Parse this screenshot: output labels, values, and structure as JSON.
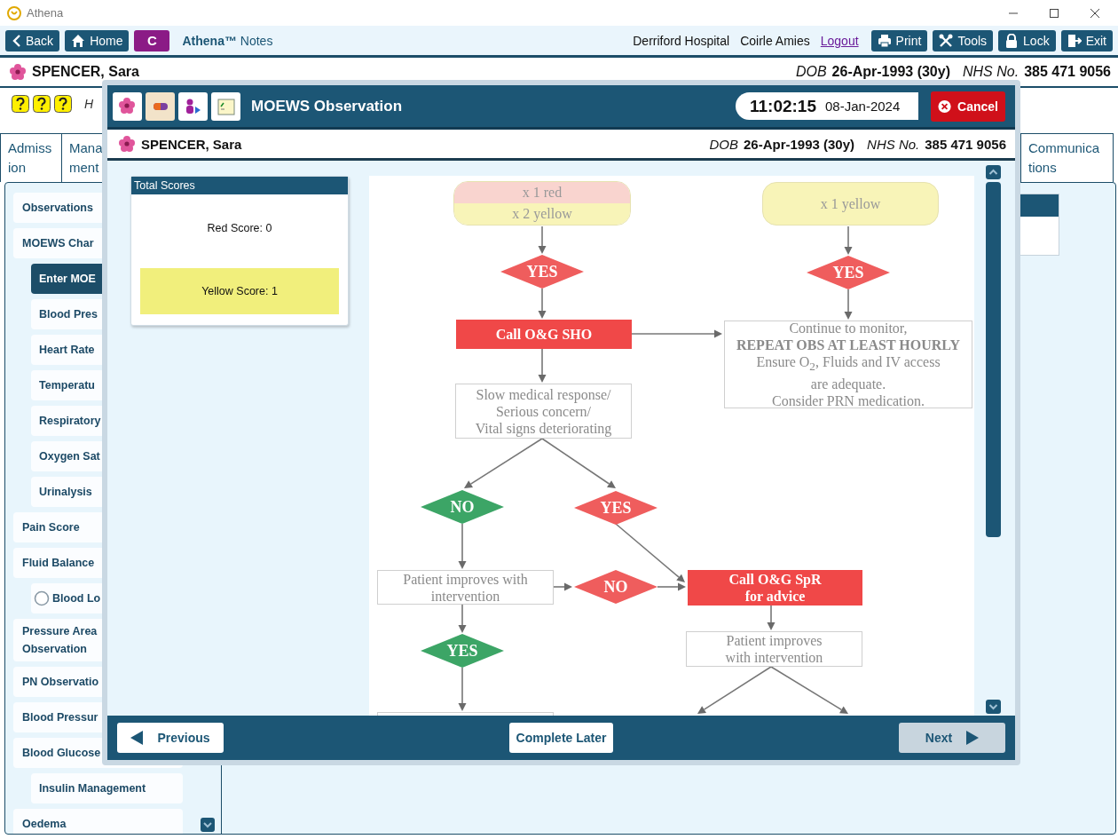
{
  "app": {
    "title": "Athena"
  },
  "toolbar": {
    "left_buttons": [
      {
        "label": "Back",
        "kind": "back"
      },
      {
        "label": "Home",
        "kind": "home"
      }
    ],
    "badge": "C",
    "app_name": "**Athena™** Notes",
    "hospital": "Derriford Hospital",
    "user": "Coirle Amies",
    "logout": "Logout",
    "right_buttons": [
      {
        "label": "Print",
        "kind": "print"
      },
      {
        "label": "Tools",
        "kind": "tools"
      },
      {
        "label": "Lock",
        "kind": "lock"
      },
      {
        "label": "Exit",
        "kind": "exit"
      }
    ]
  },
  "patient": {
    "name": "SPENCER, Sara",
    "dob_label": "DOB",
    "dob": "26-Apr-1993 (30y)",
    "nhs_label": "NHS No.",
    "nhs": "385 471 9056"
  },
  "alerts": {
    "note": "H"
  },
  "tabs": [
    {
      "lines": [
        "Admiss",
        "ion"
      ],
      "selected": false
    },
    {
      "lines": [
        "Mana",
        "ment"
      ],
      "selected": false
    },
    {
      "lines": [
        "Communica",
        "tions"
      ],
      "selected": false
    }
  ],
  "nav": [
    {
      "label": "Observations",
      "selected": false
    },
    {
      "label": "MOEWS Char",
      "selected": false,
      "children": [
        {
          "label": "Enter MOE",
          "selected": true
        },
        {
          "label": "Blood Pres",
          "selected": false
        },
        {
          "label": "Heart Rate",
          "selected": false
        },
        {
          "label": "Temperatu",
          "selected": false
        },
        {
          "label": "Respiratory",
          "selected": false
        },
        {
          "label": "Oxygen Sat",
          "selected": false
        },
        {
          "label": "Urinalysis",
          "selected": false
        }
      ]
    },
    {
      "label": "Pain Score",
      "selected": false
    },
    {
      "label": "Fluid Balance",
      "selected": false,
      "children": [
        {
          "label": "Blood Lo",
          "selected": false,
          "kind": "radio",
          "checked": false
        }
      ]
    },
    {
      "label": "Pressure Area\nObservation",
      "selected": false
    },
    {
      "label": "PN Observatio",
      "selected": false
    },
    {
      "label": "Blood Pressur",
      "selected": false
    },
    {
      "label": "Blood Glucose",
      "selected": false,
      "children": [
        {
          "label": "Insulin Management",
          "selected": false
        }
      ]
    },
    {
      "label": "Oedema",
      "selected": false
    }
  ],
  "modal": {
    "title": "MOEWS Observation",
    "time": "11:02:15",
    "date": "08-Jan-2024",
    "cancel": "Cancel",
    "patient": {
      "name": "SPENCER, Sara",
      "dob_label": "DOB",
      "dob": "26-Apr-1993 (30y)",
      "nhs_label": "NHS No.",
      "nhs": "385 471 9056"
    },
    "scores": {
      "title": "Total Scores",
      "red": "Red Score: 0",
      "yellow": "Yellow Score: 1"
    },
    "flowchart": {
      "nodes": [
        {
          "kind": "split_terminal",
          "parts": [
            {
              "text": "x 1 red",
              "color": "#f9d4cf"
            },
            {
              "text": "x 2 yellow",
              "color": "#f8f4b8"
            }
          ]
        },
        {
          "kind": "terminal",
          "color": "#f8f4b8",
          "lines": [
            "x 1 yellow"
          ]
        },
        {
          "kind": "decision",
          "color": "#ef5d5d",
          "lines": [
            "YES"
          ]
        },
        {
          "kind": "decision",
          "color": "#ef5d5d",
          "lines": [
            "YES"
          ]
        },
        {
          "kind": "action",
          "lines": [
            "Call O&G SHO"
          ]
        },
        {
          "kind": "box",
          "lines": [
            "Continue to monitor,",
            "**REPEAT OBS AT LEAST HOURLY**",
            "Ensure O$_{2}$, Fluids and IV access",
            "are adequate.",
            "Consider PRN medication."
          ]
        },
        {
          "kind": "box",
          "lines": [
            "Slow medical response/",
            "Serious concern/",
            "Vital signs deteriorating"
          ]
        },
        {
          "kind": "decision",
          "color": "#3ca566",
          "lines": [
            "NO"
          ]
        },
        {
          "kind": "decision",
          "color": "#ef5d5d",
          "lines": [
            "YES"
          ]
        },
        {
          "kind": "box",
          "lines": [
            "Patient improves with",
            "intervention"
          ]
        },
        {
          "kind": "decision",
          "color": "#ef5d5d",
          "lines": [
            "NO"
          ]
        },
        {
          "kind": "action",
          "lines": [
            "Call O&G SpR",
            "for advice"
          ]
        },
        {
          "kind": "decision",
          "color": "#3ca566",
          "lines": [
            "YES"
          ]
        },
        {
          "kind": "box",
          "lines": [
            "Patient improves",
            "with intervention"
          ]
        },
        {
          "kind": "box"
        }
      ]
    },
    "footer": {
      "previous": {
        "label": "Previous",
        "disabled": false
      },
      "complete_later": "Complete Later",
      "next": {
        "label": "Next",
        "disabled": true
      }
    }
  }
}
